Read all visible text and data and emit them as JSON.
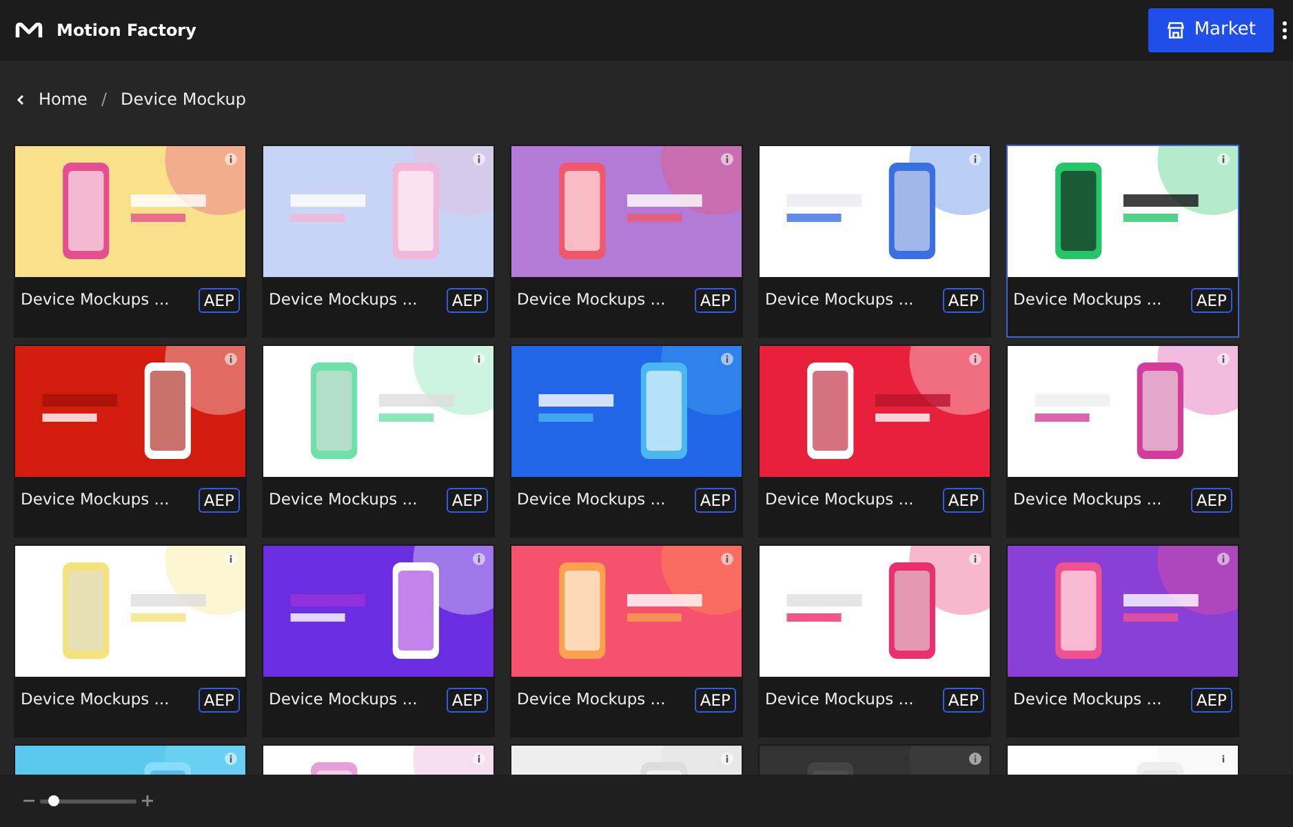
{
  "app": {
    "name": "Motion Factory"
  },
  "market_button": {
    "label": "Market"
  },
  "breadcrumb": [
    {
      "label": "Home"
    },
    {
      "label": "Device Mockup",
      "separator": "/"
    }
  ],
  "cards": [
    {
      "title": "Device Mockups ...",
      "badge": "AEP",
      "selected": false
    },
    {
      "title": "Device Mockups ...",
      "badge": "AEP",
      "selected": false
    },
    {
      "title": "Device Mockups ...",
      "badge": "AEP",
      "selected": false
    },
    {
      "title": "Device Mockups ...",
      "badge": "AEP",
      "selected": false
    },
    {
      "title": "Device Mockups ...",
      "badge": "AEP",
      "selected": true
    },
    {
      "title": "Device Mockups ...",
      "badge": "AEP",
      "selected": false
    },
    {
      "title": "Device Mockups ...",
      "badge": "AEP",
      "selected": false
    },
    {
      "title": "Device Mockups ...",
      "badge": "AEP",
      "selected": false
    },
    {
      "title": "Device Mockups ...",
      "badge": "AEP",
      "selected": false
    },
    {
      "title": "Device Mockups ...",
      "badge": "AEP",
      "selected": false
    },
    {
      "title": "Device Mockups ...",
      "badge": "AEP",
      "selected": false
    },
    {
      "title": "Device Mockups ...",
      "badge": "AEP",
      "selected": false
    },
    {
      "title": "Device Mockups ...",
      "badge": "AEP",
      "selected": false
    },
    {
      "title": "Device Mockups ...",
      "badge": "AEP",
      "selected": false
    },
    {
      "title": "Device Mockups ...",
      "badge": "AEP",
      "selected": false
    },
    {
      "selected": false
    },
    {
      "selected": false
    },
    {
      "selected": false
    },
    {
      "selected": false
    },
    {
      "selected": false
    }
  ],
  "zoom_slider": {
    "level": 0.08
  }
}
